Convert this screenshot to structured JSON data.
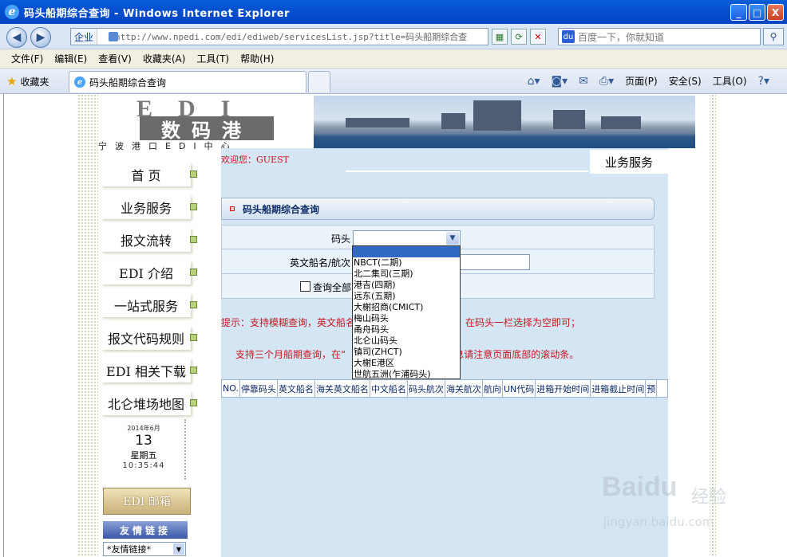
{
  "window": {
    "title": "码头船期综合查询 - Windows Internet Explorer",
    "min": "_",
    "max": "□",
    "close": "X"
  },
  "address": {
    "zone": "企业",
    "url": "http://www.npedi.com/edi/ediweb/servicesList.jsp?title=码头船期综合查",
    "search_placeholder": "百度一下，你就知道"
  },
  "menu": [
    "文件(F)",
    "编辑(E)",
    "查看(V)",
    "收藏夹(A)",
    "工具(T)",
    "帮助(H)"
  ],
  "favorites": {
    "label": "收藏夹"
  },
  "tab": {
    "title": "码头船期综合查询"
  },
  "commandbar": {
    "page": "页面(P)",
    "safety": "安全(S)",
    "tools": "工具(O)"
  },
  "site": {
    "logo_text": "EDI",
    "logo_box": "数码港",
    "logo_sub": "宁波港口EDI中心",
    "welcome": "欢迎您：GUEST",
    "section_title": "业务服务",
    "nav": [
      "首 页",
      "业务服务",
      "报文流转",
      "EDI 介绍",
      "一站式服务",
      "报文代码规则",
      "EDI 相关下载",
      "北仑堆场地图"
    ],
    "date": {
      "year_month": "2014年6月",
      "day": "13",
      "weekday": "星期五",
      "time": "10:35:44"
    },
    "mail_label": "EDI 邮箱",
    "links_title": "友情链接",
    "links_select": "*友情链接*"
  },
  "query": {
    "heading": "码头船期综合查询",
    "terminal_label": "码头",
    "ship_label": "英文船名/航次",
    "check_all_label": "查询全部",
    "tip1": "提示：支持模糊查询，英文船名",
    "tip1b": "支持所有码头查询，在码头一栏选择为空即可；",
    "tip2a": "支持三个月船期查询，在“",
    "tip2b": "信息请注意页面底部的滚动条。",
    "columns": [
      "NO.",
      "停靠码头",
      "英文船名",
      "海关英文船名",
      "中文船名",
      "码头航次",
      "海关航次",
      "航向",
      "UN代码",
      "进箱开始时间",
      "进箱截止时间",
      "预"
    ]
  },
  "dropdown_options": [
    "",
    "NBCT(二期)",
    "北二集司(三期)",
    "港吉(四期)",
    "远东(五期)",
    "大榭招商(CMICT)",
    "梅山码头",
    "甬舟码头",
    "北仑山码头",
    "镇司(ZHCT)",
    "大榭E港区",
    "世航五洲(乍浦码头)"
  ],
  "watermark": {
    "brand": "Baidu",
    "cn": "经验",
    "url": "jingyan.baidu.com"
  }
}
